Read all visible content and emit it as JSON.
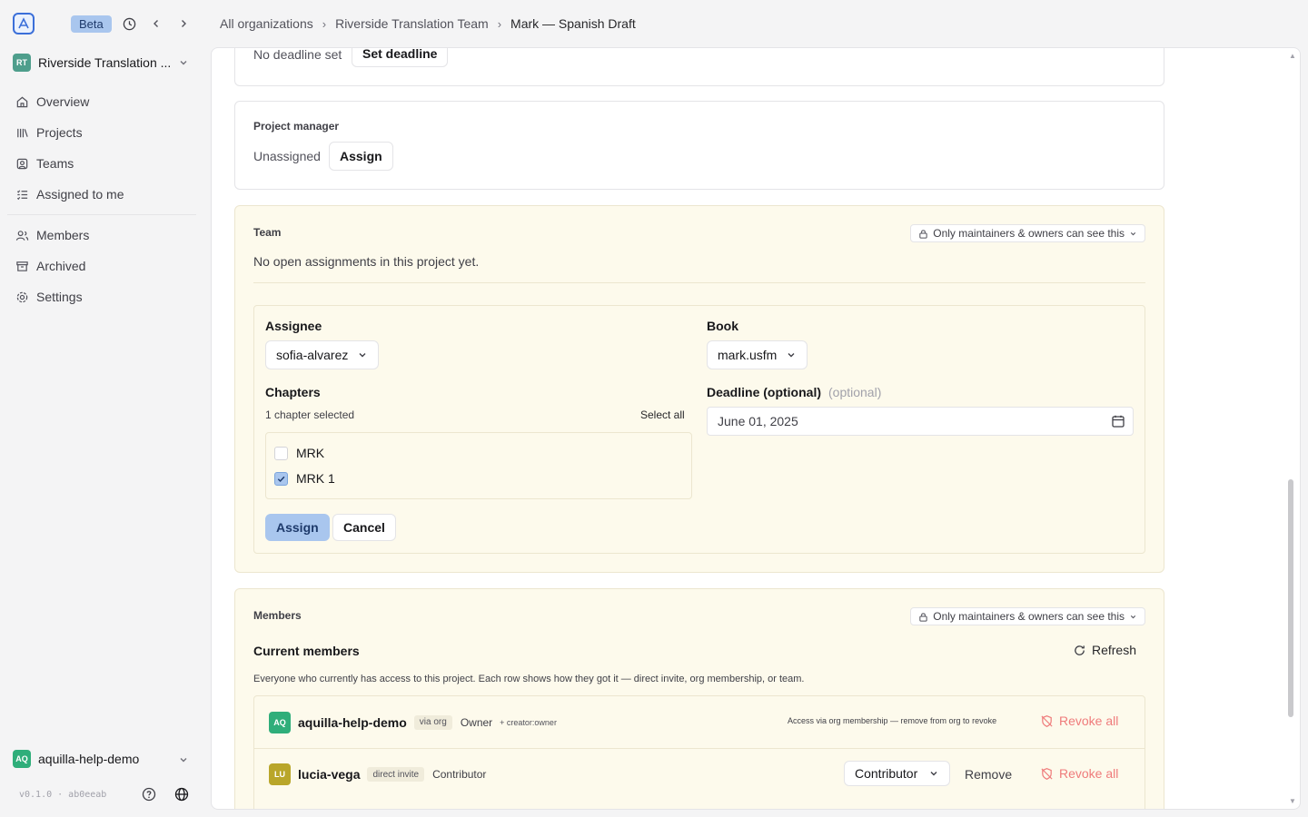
{
  "topbar": {
    "beta_label": "Beta",
    "breadcrumbs": [
      "All organizations",
      "Riverside Translation Team",
      "Mark — Spanish Draft"
    ]
  },
  "sidebar": {
    "org": {
      "initials": "RT",
      "name": "Riverside Translation ...",
      "color": "#4e9e8c"
    },
    "nav_primary": [
      {
        "label": "Overview",
        "icon": "home-icon"
      },
      {
        "label": "Projects",
        "icon": "library-icon"
      },
      {
        "label": "Teams",
        "icon": "user-square-icon"
      },
      {
        "label": "Assigned to me",
        "icon": "list-check-icon"
      }
    ],
    "nav_secondary": [
      {
        "label": "Members",
        "icon": "users-icon"
      },
      {
        "label": "Archived",
        "icon": "archive-icon"
      },
      {
        "label": "Settings",
        "icon": "gear-icon"
      }
    ],
    "user": {
      "initials": "AQ",
      "name": "aquilla-help-demo",
      "color": "#2fae7a"
    },
    "version": "v0.1.0 · ab0eeab"
  },
  "deadline": {
    "status": "No deadline set",
    "button": "Set deadline"
  },
  "project_manager": {
    "label": "Project manager",
    "status": "Unassigned",
    "button": "Assign"
  },
  "team": {
    "label": "Team",
    "visibility": "Only maintainers & owners can see this",
    "empty_text": "No open assignments in this project yet.",
    "form": {
      "assignee_label": "Assignee",
      "assignee_value": "sofia-alvarez",
      "book_label": "Book",
      "book_value": "mark.usfm",
      "chapters_label": "Chapters",
      "chapters_count": "1 chapter selected",
      "select_all": "Select all",
      "chapters": [
        {
          "label": "MRK",
          "checked": false
        },
        {
          "label": "MRK 1",
          "checked": true
        }
      ],
      "deadline_label": "Deadline (optional)",
      "deadline_hint": "(optional)",
      "deadline_value": "June 01, 2025",
      "assign_button": "Assign",
      "cancel_button": "Cancel"
    }
  },
  "members": {
    "label": "Members",
    "visibility": "Only maintainers & owners can see this",
    "title": "Current members",
    "refresh": "Refresh",
    "description": "Everyone who currently has access to this project. Each row shows how they got it — direct invite, org membership, or team.",
    "rows": [
      {
        "initials": "AQ",
        "color": "#2fae7a",
        "name": "aquilla-help-demo",
        "via": "via org",
        "role": "Owner",
        "extra": "+ creator:owner",
        "note": "Access via org membership — remove from org to revoke",
        "revoke": "Revoke all"
      },
      {
        "initials": "LU",
        "color": "#b9a62a",
        "name": "lucia-vega",
        "via": "direct invite",
        "role": "Contributor",
        "role_select": "Contributor",
        "remove": "Remove",
        "revoke": "Revoke all"
      }
    ]
  }
}
